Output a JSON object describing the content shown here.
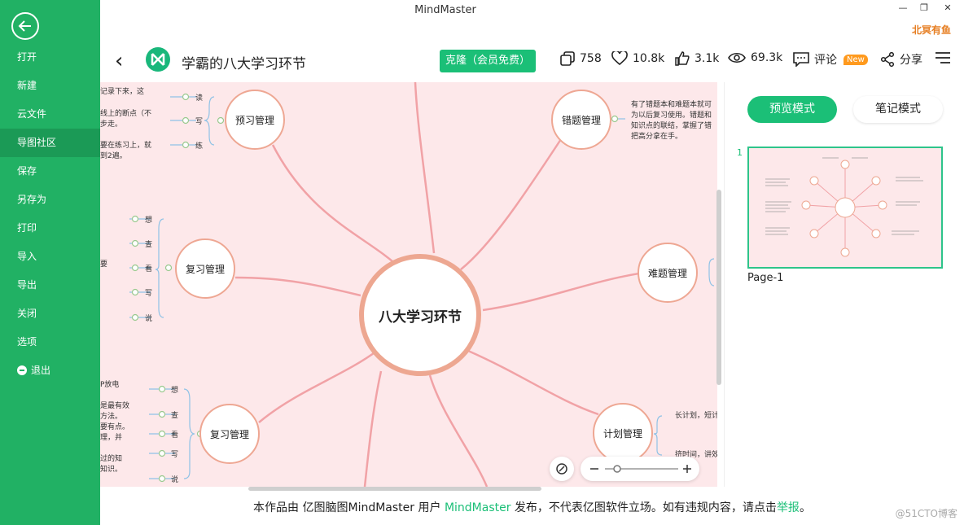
{
  "window": {
    "title": "MindMaster",
    "user": "北冥有鱼"
  },
  "sidebar": {
    "items": [
      {
        "label": "打开"
      },
      {
        "label": "新建"
      },
      {
        "label": "云文件"
      },
      {
        "label": "导图社区"
      },
      {
        "label": "保存"
      },
      {
        "label": "另存为"
      },
      {
        "label": "打印"
      },
      {
        "label": "导入"
      },
      {
        "label": "导出"
      },
      {
        "label": "关闭"
      },
      {
        "label": "选项"
      },
      {
        "label": "退出"
      }
    ]
  },
  "header": {
    "title": "学霸的八大学习环节",
    "clone_label": "克隆（会员免费）",
    "copies": "758",
    "favorites": "10.8k",
    "likes": "3.1k",
    "views": "69.3k",
    "comment_label": "评论",
    "new_badge": "New",
    "share_label": "分享"
  },
  "mindmap": {
    "center": "八大学习环节",
    "branches": {
      "preview": "预习管理",
      "review_1": "复习管理",
      "review_2": "复习管理",
      "mistakes": "错题管理",
      "hard": "难题管理",
      "plan": "计划管理"
    },
    "preview_leaves": [
      "读",
      "写",
      "练"
    ],
    "review1_leaves": [
      "想",
      "查",
      "看",
      "写",
      "说"
    ],
    "review2_leaves": [
      "想",
      "查",
      "看",
      "写",
      "说"
    ],
    "notes_preview": [
      "记录下来，这",
      "线上的断点（不",
      "步走。",
      "要在练习上，就",
      "到2遍。"
    ],
    "notes_review1": [
      "要"
    ],
    "notes_review2": [
      "P放电",
      "是最有效",
      "方法。",
      "要有点。",
      "理，并",
      "过的知",
      "知识。"
    ],
    "notes_mistakes": [
      "有了错题本和难题本就可",
      "为以后复习使用。错题和",
      "知识点的联结，掌握了错",
      "把高分拿在手。"
    ],
    "notes_plan": [
      "长计划，短计",
      "挤时间，讲效"
    ]
  },
  "right_panel": {
    "preview_mode": "预览模式",
    "notes_mode": "笔记模式",
    "page_number": "1",
    "page_label": "Page-1"
  },
  "footer": {
    "prefix": "本作品由 亿图脑图MindMaster 用户 ",
    "author": "MindMaster",
    "middle": " 发布，不代表亿图软件立场。如有违规内容，请点击",
    "report": "举报",
    "suffix": "。",
    "watermark": "@51CTO博客"
  },
  "colors": {
    "accent": "#1bbf77",
    "sidebar": "#21b164",
    "canvas": "#fde8ea",
    "branch_line": "#f1a2a6",
    "node_border": "#eea793"
  }
}
